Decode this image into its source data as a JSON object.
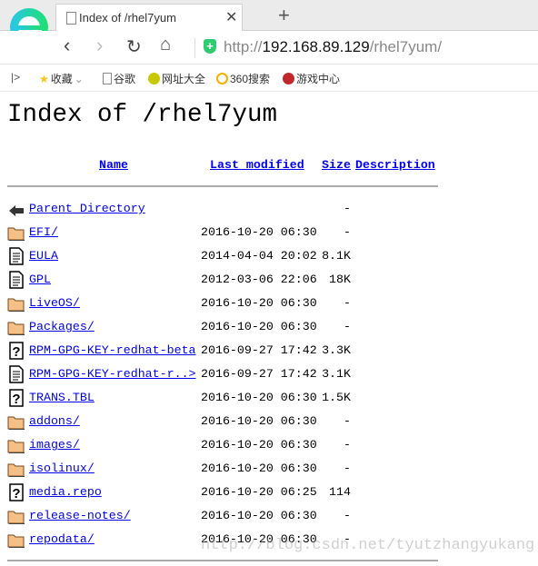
{
  "browser": {
    "tab_title": "Index of /rhel7yum",
    "url_prefix": "http://",
    "url_host": "192.168.89.129",
    "url_path": "/rhel7yum/",
    "bookmarks": [
      {
        "label": "收藏",
        "color": "#f5c518"
      },
      {
        "label": "谷歌",
        "color": "#ffffff"
      },
      {
        "label": "网址大全",
        "color": "#c8c800"
      },
      {
        "label": "360搜索",
        "color": "#f0b000"
      },
      {
        "label": "游戏中心",
        "color": "#c0282d"
      }
    ]
  },
  "page": {
    "title": "Index of /rhel7yum",
    "columns": {
      "name": "Name",
      "modified": "Last modified",
      "size": "Size",
      "description": "Description"
    },
    "rows": [
      {
        "icon": "back",
        "name": "Parent Directory",
        "date": "",
        "size": "-"
      },
      {
        "icon": "folder",
        "name": "EFI/",
        "date": "2016-10-20 06:30",
        "size": "-"
      },
      {
        "icon": "text",
        "name": "EULA",
        "date": "2014-04-04 20:02",
        "size": "8.1K"
      },
      {
        "icon": "text",
        "name": "GPL",
        "date": "2012-03-06 22:06",
        "size": "18K"
      },
      {
        "icon": "folder",
        "name": "LiveOS/",
        "date": "2016-10-20 06:30",
        "size": "-"
      },
      {
        "icon": "folder",
        "name": "Packages/",
        "date": "2016-10-20 06:30",
        "size": "-"
      },
      {
        "icon": "unknown",
        "name": "RPM-GPG-KEY-redhat-beta",
        "date": "2016-09-27 17:42",
        "size": "3.3K"
      },
      {
        "icon": "text",
        "name": "RPM-GPG-KEY-redhat-r..>",
        "date": "2016-09-27 17:42",
        "size": "3.1K"
      },
      {
        "icon": "unknown",
        "name": "TRANS.TBL",
        "date": "2016-10-20 06:30",
        "size": "1.5K"
      },
      {
        "icon": "folder",
        "name": "addons/",
        "date": "2016-10-20 06:30",
        "size": "-"
      },
      {
        "icon": "folder",
        "name": "images/",
        "date": "2016-10-20 06:30",
        "size": "-"
      },
      {
        "icon": "folder",
        "name": "isolinux/",
        "date": "2016-10-20 06:30",
        "size": "-"
      },
      {
        "icon": "unknown",
        "name": "media.repo",
        "date": "2016-10-20 06:25",
        "size": "114"
      },
      {
        "icon": "folder",
        "name": "release-notes/",
        "date": "2016-10-20 06:30",
        "size": "-"
      },
      {
        "icon": "folder",
        "name": "repodata/",
        "date": "2016-10-20 06:30",
        "size": "-"
      }
    ]
  },
  "watermark": "http://blog.csdn.net/tyutzhangyukang"
}
